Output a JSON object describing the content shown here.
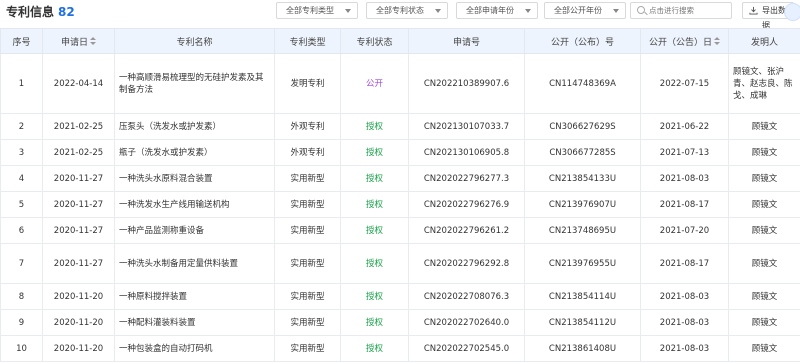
{
  "header": {
    "title": "专利信息",
    "count": "82",
    "filters": [
      "全部专利类型",
      "全部专利状态",
      "全部申请年份",
      "全部公开年份"
    ],
    "search_placeholder": "点击进行搜索",
    "export_label": "导出数据"
  },
  "colors": {
    "accent": "#1f6fe6",
    "open": "#a54bd6",
    "granted": "#1aa34a",
    "header_bg": "#eef4fd"
  },
  "table": {
    "columns": [
      "序号",
      "申请日",
      "专利名称",
      "专利类型",
      "专利状态",
      "申请号",
      "公开（公布）号",
      "公开（公告）日",
      "发明人"
    ],
    "rows": [
      {
        "no": "1",
        "apply_date": "2022-04-14",
        "name": "一种高顺滑易梳理型的无硅护发素及其制备方法",
        "type": "发明专利",
        "status": "公开",
        "app_no": "CN202210389907.6",
        "pub_no": "CN114748369A",
        "pub_date": "2022-07-15",
        "inventor": "顾镜文、张沪青、赵志良、陈戈、成琳"
      },
      {
        "no": "2",
        "apply_date": "2021-02-25",
        "name": "压泵头（洗发水或护发素）",
        "type": "外观专利",
        "status": "授权",
        "app_no": "CN202130107033.7",
        "pub_no": "CN306627629S",
        "pub_date": "2021-06-22",
        "inventor": "顾镜文"
      },
      {
        "no": "3",
        "apply_date": "2021-02-25",
        "name": "瓶子（洗发水或护发素）",
        "type": "外观专利",
        "status": "授权",
        "app_no": "CN202130106905.8",
        "pub_no": "CN306677285S",
        "pub_date": "2021-07-13",
        "inventor": "顾镜文"
      },
      {
        "no": "4",
        "apply_date": "2020-11-27",
        "name": "一种洗头水原料混合装置",
        "type": "实用新型",
        "status": "授权",
        "app_no": "CN202022796277.3",
        "pub_no": "CN213854133U",
        "pub_date": "2021-08-03",
        "inventor": "顾镜文"
      },
      {
        "no": "5",
        "apply_date": "2020-11-27",
        "name": "一种洗发水生产线用输送机构",
        "type": "实用新型",
        "status": "授权",
        "app_no": "CN202022796276.9",
        "pub_no": "CN213976907U",
        "pub_date": "2021-08-17",
        "inventor": "顾镜文"
      },
      {
        "no": "6",
        "apply_date": "2020-11-27",
        "name": "一种产品监测称重设备",
        "type": "实用新型",
        "status": "授权",
        "app_no": "CN202022796261.2",
        "pub_no": "CN213748695U",
        "pub_date": "2021-07-20",
        "inventor": "顾镜文"
      },
      {
        "no": "7",
        "apply_date": "2020-11-27",
        "name": "一种洗头水制备用定量供料装置",
        "type": "实用新型",
        "status": "授权",
        "app_no": "CN202022796292.8",
        "pub_no": "CN213976955U",
        "pub_date": "2021-08-17",
        "inventor": "顾镜文"
      },
      {
        "no": "8",
        "apply_date": "2020-11-20",
        "name": "一种原料搅拌装置",
        "type": "实用新型",
        "status": "授权",
        "app_no": "CN202022708076.3",
        "pub_no": "CN213854114U",
        "pub_date": "2021-08-03",
        "inventor": "顾镜文"
      },
      {
        "no": "9",
        "apply_date": "2020-11-20",
        "name": "一种配料灌装料装置",
        "type": "实用新型",
        "status": "授权",
        "app_no": "CN202022702640.0",
        "pub_no": "CN213854112U",
        "pub_date": "2021-08-03",
        "inventor": "顾镜文"
      },
      {
        "no": "10",
        "apply_date": "2020-11-20",
        "name": "一种包装盒的自动打码机",
        "type": "实用新型",
        "status": "授权",
        "app_no": "CN202022702545.0",
        "pub_no": "CN213861408U",
        "pub_date": "2021-08-03",
        "inventor": "顾镜文"
      }
    ]
  }
}
